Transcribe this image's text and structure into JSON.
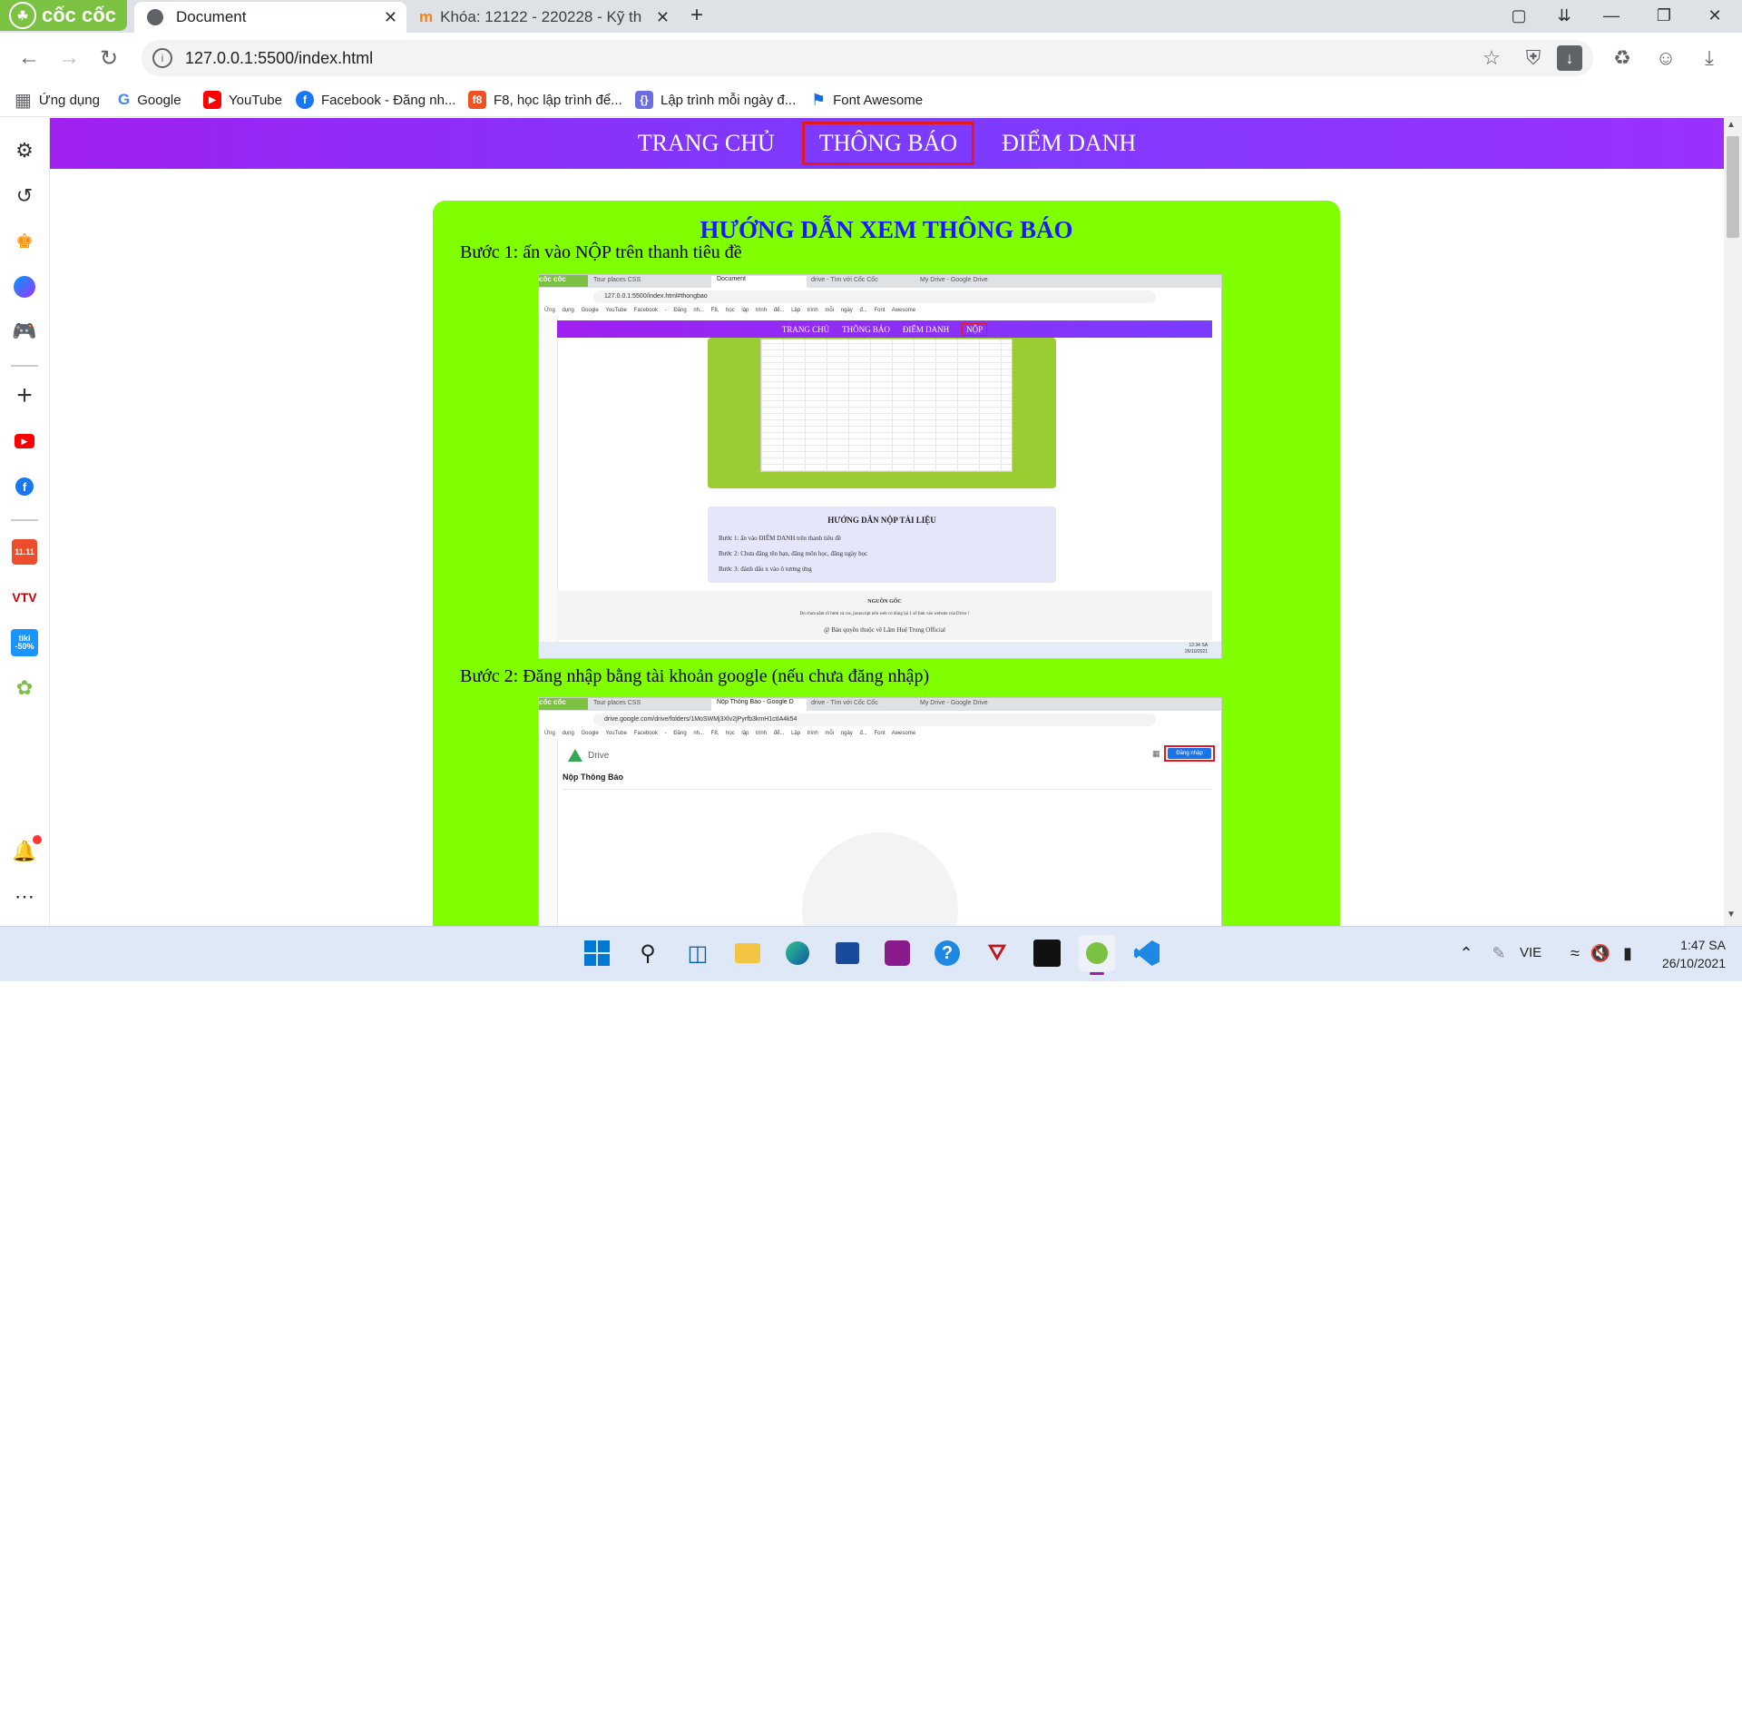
{
  "browser": {
    "logo_text": "cốc cốc",
    "tabs": [
      {
        "title": "Document",
        "active": true
      },
      {
        "title": "Khóa: 12122 - 220228 - Kỹ th",
        "active": false
      }
    ],
    "address": "127.0.0.1:5500/index.html"
  },
  "bookmarks": [
    {
      "label": "Ứng dụng",
      "icon": "apps-grid-icon"
    },
    {
      "label": "Google",
      "icon": "google-icon"
    },
    {
      "label": "YouTube",
      "icon": "youtube-icon"
    },
    {
      "label": "Facebook - Đăng nh...",
      "icon": "facebook-icon"
    },
    {
      "label": "F8, học lập trình để...",
      "icon": "f8-icon"
    },
    {
      "label": "Lập trình mỗi ngày đ...",
      "icon": "code-icon"
    },
    {
      "label": "Font Awesome",
      "icon": "flag-icon"
    }
  ],
  "site_nav": [
    "TRANG CHỦ",
    "THÔNG BÁO",
    "ĐIỂM DANH"
  ],
  "card": {
    "title": "HƯỚNG DẪN XEM THÔNG BÁO",
    "step1": "Bước 1: ấn vào NỘP trên thanh tiêu đề",
    "step2": "Bước 2: Đăng nhập bằng tài khoản google (nếu chưa đăng nhập)"
  },
  "shot1": {
    "tabs": [
      "Tour places CSS",
      "Document",
      "drive - Tìm với Cốc Cốc",
      "My Drive - Google Drive"
    ],
    "url": "127.0.0.1:5500/index.html#thongbao",
    "nav": [
      "TRANG CHỦ",
      "THÔNG BÁO",
      "ĐIỂM DANH",
      "NỘP"
    ],
    "box_title": "HƯỚNG DẪN NỘP TÀI LIỆU",
    "box_lines": [
      "Bước 1: ấn vào ĐIỂM DANH trên thanh tiêu đề",
      "Bước 2: Chưa đăng tên bạn, đăng môn học, đăng ngày học",
      "Bước 3: đánh dấu x vào ô tương ứng"
    ],
    "footer_title": "NGUỒN GỐC",
    "footer_line": "Do chưa nắm rõ html và css, javascript nên web có dùng lại 1 số link vào website của Drive !",
    "footer_copy": "@ Bản quyền thuộc về Lâm Huệ Trung Official",
    "clock_time": "12:34 SA",
    "clock_date": "26/10/2021"
  },
  "shot2": {
    "tabs": [
      "Tour places CSS",
      "Nộp Thông Báo - Google D",
      "drive - Tìm với Cốc Cốc",
      "My Drive - Google Drive"
    ],
    "url": "drive.google.com/drive/folders/1MoSWMj3Xlv2jPyrfb3kmH1ctIA4k54",
    "drive_label": "Drive",
    "signin": "Đăng nhập",
    "folder": "Nộp Thông Báo"
  },
  "taskbar": {
    "lang": "VIE",
    "time": "1:47 SA",
    "date": "26/10/2021"
  },
  "colors": {
    "nav_gradient_start": "#a020f0",
    "nav_gradient_end": "#9b30ff",
    "card_bg": "#80ff00",
    "card_title": "#1a1aff",
    "highlight_border": "#e5171f",
    "coccoc_green": "#7cc242"
  }
}
